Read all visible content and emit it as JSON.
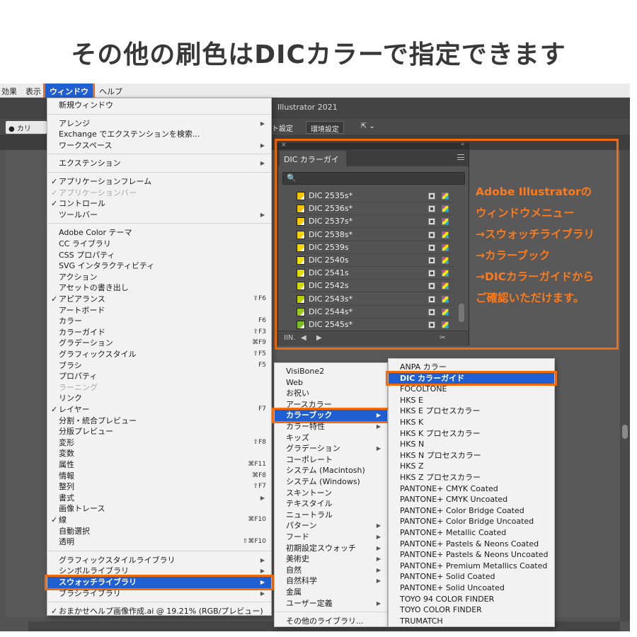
{
  "headline": "その他の刷色はDICカラーで指定できます",
  "menubar": {
    "items": [
      "効果",
      "表示",
      "ウィンドウ",
      "ヘルプ"
    ],
    "active": "ウィンドウ"
  },
  "titlebar": {
    "title": "Illustrator 2021"
  },
  "controlbar": {
    "fill_label": "● カリ",
    "doc_setup": "ト設定",
    "prefs": "環境設定"
  },
  "window_menu": {
    "items": [
      {
        "label": "新規ウィンドウ"
      },
      {
        "sep": true
      },
      {
        "label": "アレンジ",
        "arrow": true
      },
      {
        "label": "Exchange でエクステンションを検索..."
      },
      {
        "label": "ワークスペース",
        "arrow": true
      },
      {
        "sep": true
      },
      {
        "label": "エクステンション",
        "arrow": true
      },
      {
        "sep": true
      },
      {
        "label": "アプリケーションフレーム",
        "check": true
      },
      {
        "label": "アプリケーションバー",
        "check": true,
        "disabled": true
      },
      {
        "label": "コントロール",
        "check": true
      },
      {
        "label": "ツールバー",
        "arrow": true
      },
      {
        "sep": true
      },
      {
        "label": "Adobe Color テーマ"
      },
      {
        "label": "CC ライブラリ"
      },
      {
        "label": "CSS プロパティ"
      },
      {
        "label": "SVG インタラクティビティ"
      },
      {
        "label": "アクション"
      },
      {
        "label": "アセットの書き出し"
      },
      {
        "label": "アピアランス",
        "check": true,
        "shortcut": "⇧F6"
      },
      {
        "label": "アートボード"
      },
      {
        "label": "カラー",
        "shortcut": "F6"
      },
      {
        "label": "カラーガイド",
        "shortcut": "⇧F3"
      },
      {
        "label": "グラデーション",
        "shortcut": "⌘F9"
      },
      {
        "label": "グラフィックスタイル",
        "shortcut": "⇧F5"
      },
      {
        "label": "ブラシ",
        "shortcut": "F5"
      },
      {
        "label": "プロパティ"
      },
      {
        "label": "ラーニング",
        "disabled": true
      },
      {
        "label": "リンク"
      },
      {
        "label": "レイヤー",
        "check": true,
        "shortcut": "F7"
      },
      {
        "label": "分割・統合プレビュー"
      },
      {
        "label": "分版プレビュー"
      },
      {
        "label": "変形",
        "shortcut": "⇧F8"
      },
      {
        "label": "変数"
      },
      {
        "label": "属性",
        "shortcut": "⌘F11"
      },
      {
        "label": "情報",
        "shortcut": "⌘F8"
      },
      {
        "label": "整列",
        "shortcut": "⇧F7"
      },
      {
        "label": "書式",
        "arrow": true
      },
      {
        "label": "画像トレース"
      },
      {
        "label": "線",
        "check": true,
        "shortcut": "⌘F10"
      },
      {
        "label": "自動選択"
      },
      {
        "label": "透明",
        "shortcut": "⇧⌘F10"
      },
      {
        "sep": true
      },
      {
        "label": "グラフィックスタイルライブラリ",
        "arrow": true
      },
      {
        "label": "シンボルライブラリ",
        "arrow": true
      },
      {
        "label": "スウォッチライブラリ",
        "arrow": true,
        "highlight": true
      },
      {
        "label": "ブラシライブラリ",
        "arrow": true
      },
      {
        "sep": true
      },
      {
        "label": "おまかせヘルプ画像作成.ai @ 19.21% (RGB/プレビュー)",
        "check": true
      }
    ]
  },
  "swatch_menu": {
    "items": [
      {
        "label": "VisiBone2"
      },
      {
        "label": "Web"
      },
      {
        "label": "お祝い"
      },
      {
        "label": "アースカラー"
      },
      {
        "label": "カラーブック",
        "arrow": true,
        "highlight": true
      },
      {
        "label": "カラー特性",
        "arrow": true
      },
      {
        "label": "キッズ"
      },
      {
        "label": "グラデーション",
        "arrow": true
      },
      {
        "label": "コーポレート"
      },
      {
        "label": "システム (Macintosh)"
      },
      {
        "label": "システム (Windows)"
      },
      {
        "label": "スキントーン"
      },
      {
        "label": "テキスタイル"
      },
      {
        "label": "ニュートラル"
      },
      {
        "label": "パターン",
        "arrow": true
      },
      {
        "label": "フード",
        "arrow": true
      },
      {
        "label": "初期設定スウォッチ",
        "arrow": true
      },
      {
        "label": "美術史",
        "arrow": true
      },
      {
        "label": "自然",
        "arrow": true
      },
      {
        "label": "自然科学",
        "arrow": true
      },
      {
        "label": "金属"
      },
      {
        "label": "ユーザー定義",
        "arrow": true
      },
      {
        "sep": true
      },
      {
        "label": "その他のライブラリ..."
      }
    ]
  },
  "colorbook_menu": {
    "items": [
      {
        "label": "ANPA カラー"
      },
      {
        "label": "DIC カラーガイド",
        "highlight": true
      },
      {
        "label": "FOCOLTONE"
      },
      {
        "label": "HKS E"
      },
      {
        "label": "HKS E プロセスカラー"
      },
      {
        "label": "HKS K"
      },
      {
        "label": "HKS K プロセスカラー"
      },
      {
        "label": "HKS N"
      },
      {
        "label": "HKS N プロセスカラー"
      },
      {
        "label": "HKS Z"
      },
      {
        "label": "HKS Z プロセスカラー"
      },
      {
        "label": "PANTONE+ CMYK Coated"
      },
      {
        "label": "PANTONE+ CMYK Uncoated"
      },
      {
        "label": "PANTONE+ Color Bridge Coated"
      },
      {
        "label": "PANTONE+ Color Bridge Uncoated"
      },
      {
        "label": "PANTONE+ Metallic Coated"
      },
      {
        "label": "PANTONE+ Pastels & Neons Coated"
      },
      {
        "label": "PANTONE+ Pastels & Neons Uncoated"
      },
      {
        "label": "PANTONE+ Premium Metallics Coated"
      },
      {
        "label": "PANTONE+ Solid Coated"
      },
      {
        "label": "PANTONE+ Solid Uncoated"
      },
      {
        "label": "TOYO 94 COLOR FINDER"
      },
      {
        "label": "TOYO COLOR FINDER"
      },
      {
        "label": "TRUMATCH"
      }
    ]
  },
  "dic_panel": {
    "tab": "DIC カラーガイド",
    "search_icon": "search-icon",
    "swatches": [
      {
        "name": "DIC 2535s*",
        "color": "#f5c400"
      },
      {
        "name": "DIC 2536s*",
        "color": "#f3c200"
      },
      {
        "name": "DIC 2537s*",
        "color": "#f5c800"
      },
      {
        "name": "DIC 2538s*",
        "color": "#f7d000"
      },
      {
        "name": "DIC 2539s",
        "color": "#f5d800"
      },
      {
        "name": "DIC 2540s",
        "color": "#f0e000"
      },
      {
        "name": "DIC 2541s",
        "color": "#e4dc00"
      },
      {
        "name": "DIC 2542s",
        "color": "#d2d800"
      },
      {
        "name": "DIC 2543s*",
        "color": "#b8d000"
      },
      {
        "name": "DIC 2544s*",
        "color": "#9cc820"
      },
      {
        "name": "DIC 2545s*",
        "color": "#7cbe2a"
      }
    ]
  },
  "annotation": {
    "lines": [
      "Adobe Illustratorの",
      "ウィンドウメニュー",
      "→スウォッチライブラリ",
      "→カラーブック",
      "→DICカラーガイドから",
      "ご確認いただけます。"
    ]
  },
  "colors": {
    "accent": "#f26b0a",
    "highlight": "#1f5fd1"
  }
}
